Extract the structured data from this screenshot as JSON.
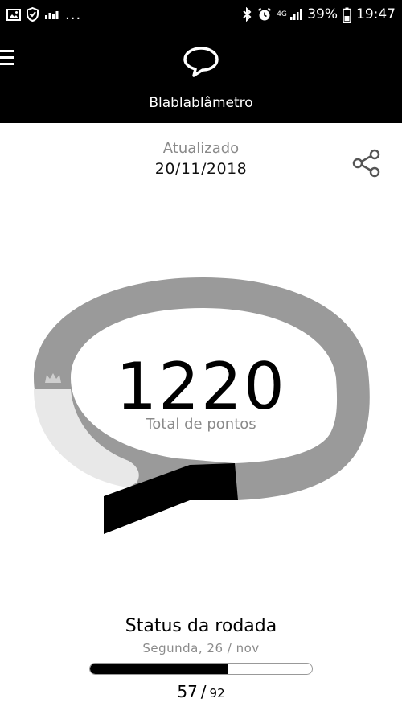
{
  "status_bar": {
    "battery": "39%",
    "time": "19:47",
    "network": "4G",
    "dots": "...",
    "icons": [
      "image-icon",
      "shield-icon",
      "signal-bars-icon",
      "bluetooth-icon",
      "alarm-icon",
      "battery-icon"
    ]
  },
  "header": {
    "title": "Blablablâmetro",
    "menu_icon": "menu-icon",
    "logo_icon": "speech-bubble-icon"
  },
  "update": {
    "label": "Atualizado",
    "date": "20/11/2018",
    "share_icon": "share-icon"
  },
  "gauge": {
    "total": "1220",
    "total_label": "Total de pontos",
    "marker_icon": "crown-icon",
    "colors": {
      "track": "#9a9a9a",
      "light": "#e6e6e6",
      "tail": "#000000",
      "marker": "#cfcfcf"
    }
  },
  "round_status": {
    "title": "Status da rodada",
    "date": "Segunda, 26 / nov",
    "current": "57",
    "separator": "/",
    "max": "92",
    "progress": 0.62
  }
}
